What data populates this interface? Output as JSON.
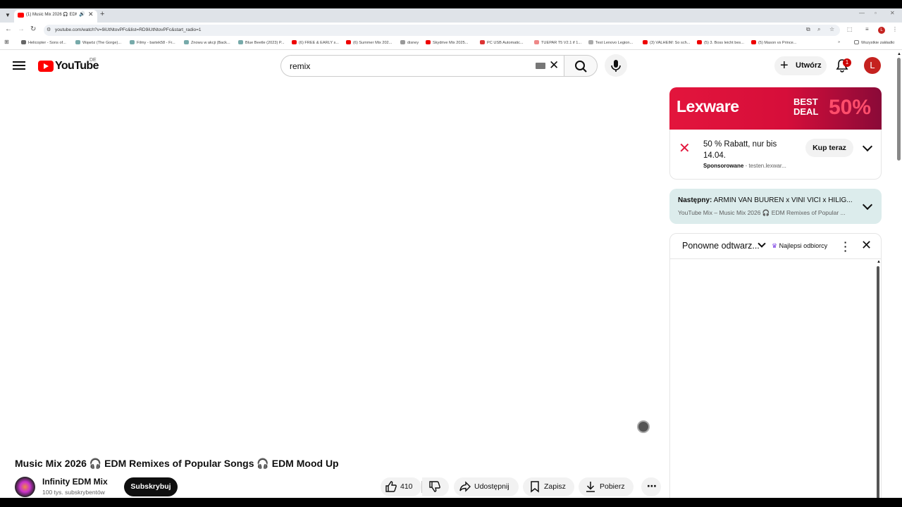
{
  "browser": {
    "tab_title": "(1) Music Mix 2026 🎧 EDM",
    "url": "youtube.com/watch?v=9iUtNtovPFc&list=RD9iUtNtovPFc&start_radio=1",
    "bookmarks": [
      "Helicopter - Sons of...",
      "Wąwóz (The Gorge)...",
      "Filmy - bartek58 - Fr...",
      "Znowu w akcji (Back...",
      "Blue Beetle (2023) P...",
      "(6) FREE & EARLY s...",
      "(6) Summer Mix 202...",
      "disney",
      "Skydrive Mix 2025...",
      "PC USB Automatic...",
      "TUEPAR T5 V2.1 if 1...",
      "Test Lenovo Legion...",
      "(3) VALHEIM: So sch...",
      "(5) 3. Boss leicht bes...",
      "(5) Mason vs Prince..."
    ],
    "all_bookmarks": "Wszystkie zakładki",
    "profile_initial": "L"
  },
  "header": {
    "logo_text": "YouTube",
    "region": "DE",
    "search_query": "remix",
    "create_label": "Utwórz",
    "notification_count": "1",
    "avatar_initial": "L"
  },
  "video": {
    "title": "Music Mix 2026 🎧 EDM Remixes of Popular Songs 🎧 EDM Mood Up",
    "channel_name": "Infinity EDM Mix",
    "subscribers": "100 tys. subskrybentów",
    "subscribe_label": "Subskrybuj",
    "likes": "410",
    "share_label": "Udostępnij",
    "save_label": "Zapisz",
    "download_label": "Pobierz"
  },
  "ad": {
    "brand": "Lexware",
    "banner_deal": "BEST DEAL",
    "banner_percent": "50%",
    "text": "50 % Rabatt, nur bis 14.04.",
    "sponsored": "Sponsorowane",
    "domain": "testen.lexwar...",
    "cta": "Kup teraz"
  },
  "next": {
    "prefix": "Następny:",
    "title": "ARMIN VAN BUUREN x VINI VICI x HILIG...",
    "subtitle": "YouTube Mix – Music Mix 2026 🎧 EDM Remixes of Popular ..."
  },
  "playlist": {
    "header": "Ponowne odtwarz...",
    "badge": "Najlepsi odbiorcy"
  },
  "colors": {
    "youtube_red": "#ff0000",
    "ad_red": "#e3153c",
    "next_bg": "#dcecec"
  }
}
